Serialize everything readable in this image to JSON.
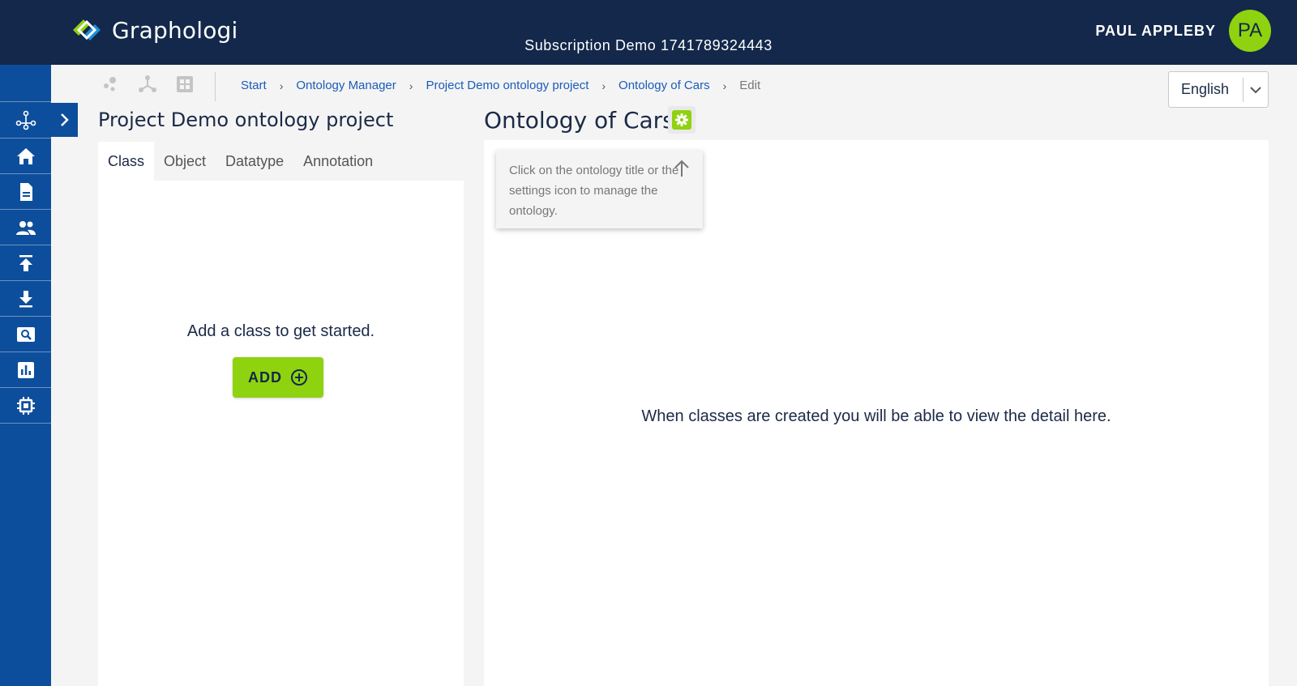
{
  "header": {
    "app_name": "Graphologi",
    "subscription": "Subscription Demo 1741789324443",
    "user_name": "PAUL APPLEBY",
    "avatar_initials": "PA"
  },
  "sidebar": {
    "items": [
      {
        "name": "ontology-graph",
        "icon": "graph-nodes-icon"
      },
      {
        "name": "home",
        "icon": "home-icon"
      },
      {
        "name": "documents",
        "icon": "document-icon"
      },
      {
        "name": "users",
        "icon": "users-icon"
      },
      {
        "name": "upload",
        "icon": "upload-icon"
      },
      {
        "name": "download",
        "icon": "download-icon"
      },
      {
        "name": "search",
        "icon": "search-icon"
      },
      {
        "name": "reports",
        "icon": "chart-icon"
      },
      {
        "name": "processor",
        "icon": "chip-icon"
      }
    ],
    "expand_icon": "chevron-right-icon"
  },
  "toolbar": {
    "icons": [
      "scatter-nodes-icon",
      "branch-nodes-icon",
      "grid-icon"
    ]
  },
  "breadcrumb": {
    "items": [
      "Start",
      "Ontology Manager",
      "Project Demo ontology project",
      "Ontology of Cars"
    ],
    "current": "Edit"
  },
  "language": {
    "selected": "English"
  },
  "left_panel": {
    "title": "Project Demo ontology project",
    "tabs": [
      "Class",
      "Object",
      "Datatype",
      "Annotation"
    ],
    "active_tab": "Class",
    "empty_message": "Add a class to get started.",
    "add_label": "ADD"
  },
  "right_panel": {
    "title": "Ontology of Cars",
    "hint": "Click on the ontology title or the settings icon to manage the ontology.",
    "detail_message": "When classes are created you will be able to view the detail here."
  },
  "colors": {
    "header_bg": "#13284a",
    "sidebar_bg": "#0d4e9c",
    "accent_green": "#8fd20f",
    "link_blue": "#1a5cb8"
  }
}
